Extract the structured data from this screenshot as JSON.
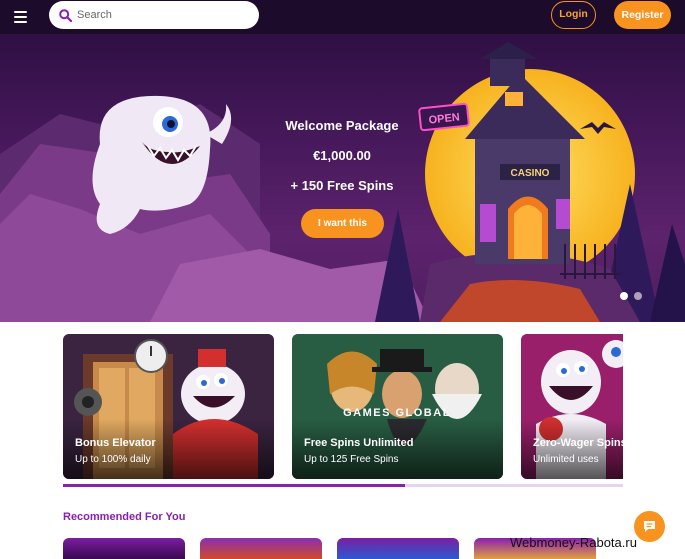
{
  "topbar": {
    "search_placeholder": "Search",
    "login_label": "Login",
    "register_label": "Register",
    "background_color": "#1c0b2a",
    "accent_color": "#f7931e"
  },
  "hero": {
    "line1": "Welcome Package",
    "line2": "€1,000.00",
    "line3": "+ 150 Free Spins",
    "cta_label": "I want this",
    "sign_text": "OPEN",
    "building_sign": "CASINO",
    "slides_total": 2,
    "slide_active": 1
  },
  "promos": [
    {
      "title": "Bonus Elevator",
      "subtitle": "Up to 100% daily"
    },
    {
      "title": "Free Spins Unlimited",
      "subtitle": "Up to 125 Free Spins",
      "logo_text": "GAMES GLOBAL"
    },
    {
      "title": "Zero-Wager Spins",
      "subtitle": "Unlimited uses"
    }
  ],
  "carousel_progress": 0.61,
  "recommended": {
    "title": "Recommended For You"
  },
  "chat": {
    "icon": "chat-bubble-icon"
  },
  "watermark": "Webmoney-Rabota.ru"
}
